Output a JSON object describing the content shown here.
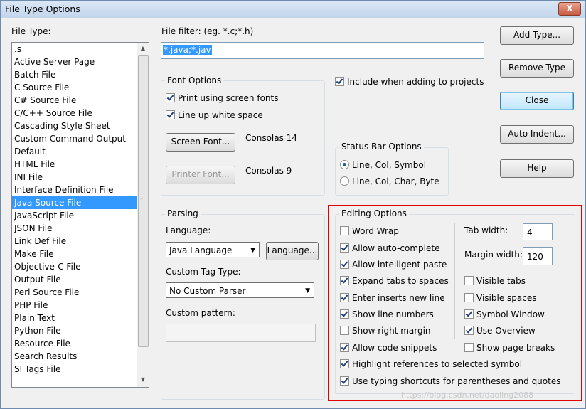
{
  "window": {
    "title": "File Type Options",
    "close_glyph": "X"
  },
  "file_type": {
    "label": "File Type:",
    "items": [
      ".s",
      "Active Server Page",
      "Batch File",
      "C Source File",
      "C# Source File",
      "C/C++ Source File",
      "Cascading Style Sheet",
      "Custom Command Output",
      "Default",
      "HTML File",
      "INI File",
      "Interface Definition File",
      "Java Source File",
      "JavaScript File",
      "JSON File",
      "Link Def File",
      "Make File",
      "Objective-C File",
      "Output File",
      "Perl Source File",
      "PHP File",
      "Plain Text",
      "Python File",
      "Resource File",
      "Search Results",
      "SI Tags File"
    ],
    "selected": "Java Source File"
  },
  "file_filter": {
    "label": "File filter: (eg. *.c;*.h)",
    "value": "*.java;*.jav"
  },
  "font_options": {
    "title": "Font Options",
    "print_screen_fonts": {
      "label": "Print using screen fonts",
      "checked": true
    },
    "line_up_white_space": {
      "label": "Line up white space",
      "checked": true
    },
    "screen_font_button": "Screen Font...",
    "screen_font_value": "Consolas 14",
    "printer_font_button": "Printer Font...",
    "printer_font_value": "Consolas 9"
  },
  "include_projects": {
    "label": "Include when adding to projects",
    "checked": true
  },
  "status_bar": {
    "title": "Status Bar Options",
    "options": [
      "Line, Col, Symbol",
      "Line, Col, Char, Byte"
    ],
    "selected": "Line, Col, Symbol"
  },
  "parsing": {
    "title": "Parsing",
    "language_label": "Language:",
    "language_value": "Java Language",
    "language_button": "Language...",
    "custom_tag_label": "Custom Tag Type:",
    "custom_tag_value": "No Custom Parser",
    "custom_pattern_label": "Custom pattern:",
    "custom_pattern_value": ""
  },
  "editing": {
    "title": "Editing Options",
    "left": [
      {
        "label": "Word Wrap",
        "checked": false
      },
      {
        "label": "Allow auto-complete",
        "checked": true
      },
      {
        "label": "Allow intelligent paste",
        "checked": true
      },
      {
        "label": "Expand tabs to spaces",
        "checked": true
      },
      {
        "label": "Enter inserts new line",
        "checked": true
      },
      {
        "label": "Show line numbers",
        "checked": true
      },
      {
        "label": "Show right margin",
        "checked": false
      },
      {
        "label": "Allow code snippets",
        "checked": true
      },
      {
        "label": "Highlight references to selected symbol",
        "checked": true
      },
      {
        "label": "Use typing shortcuts for parentheses and quotes",
        "checked": true
      }
    ],
    "tab_width_label": "Tab width:",
    "tab_width_value": "4",
    "margin_width_label": "Margin width:",
    "margin_width_value": "120",
    "right": [
      {
        "label": "Visible tabs",
        "checked": false
      },
      {
        "label": "Visible spaces",
        "checked": false
      },
      {
        "label": "Symbol Window",
        "checked": true
      },
      {
        "label": "Use Overview",
        "checked": true
      },
      {
        "label": "Show page breaks",
        "checked": false
      }
    ]
  },
  "buttons": {
    "add_type": "Add Type...",
    "remove_type": "Remove Type",
    "close": "Close",
    "auto_indent": "Auto Indent...",
    "help": "Help"
  },
  "watermark": "https://blog.csdn.net/daoling2088",
  "colors": {
    "highlight_frame": "#e30000",
    "selection": "#3399ff"
  }
}
